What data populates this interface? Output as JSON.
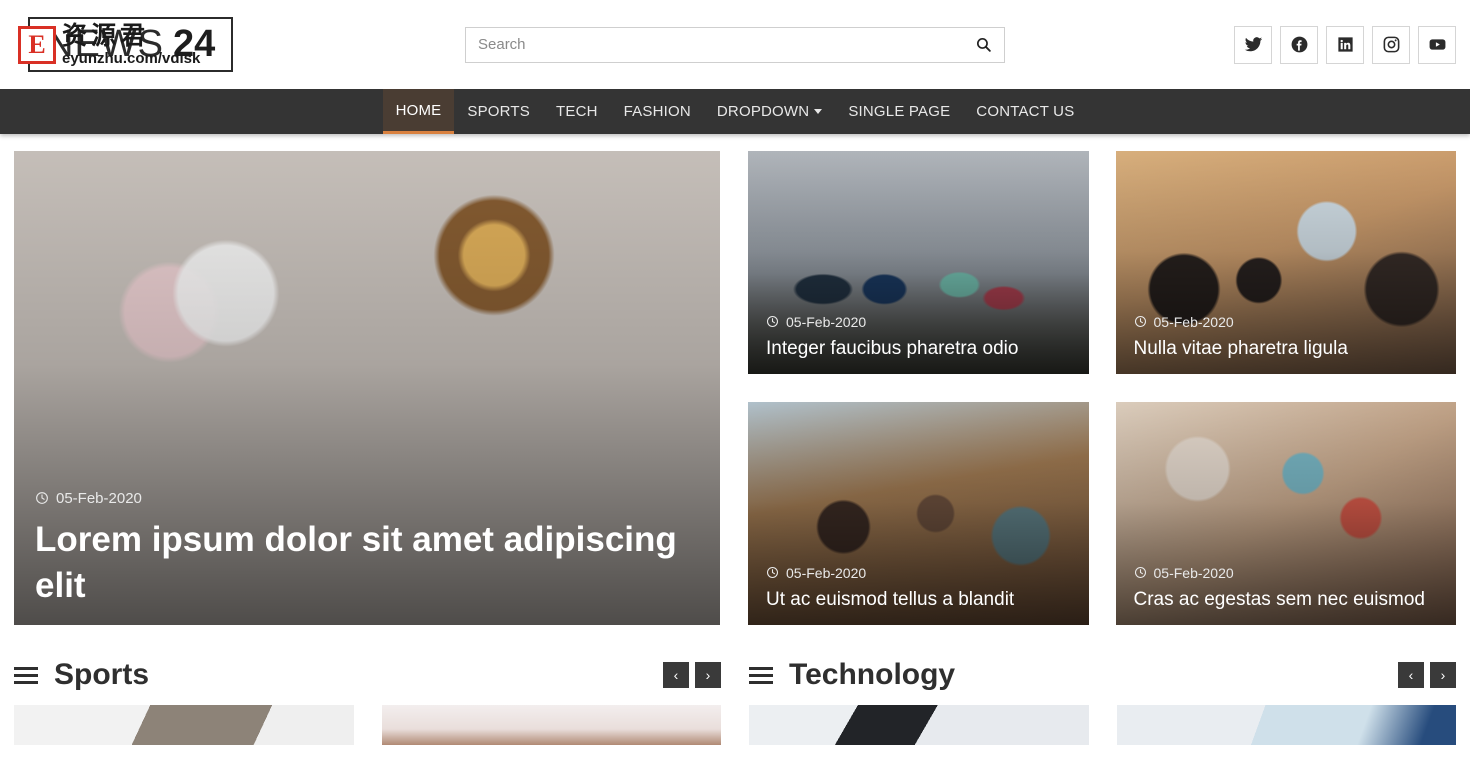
{
  "header": {
    "logo": {
      "word": "NEWS",
      "number": "24"
    },
    "watermark": {
      "badge_letter": "E",
      "chinese": "资源君",
      "url": "eyunzhu.com/vdisk"
    },
    "search": {
      "placeholder": "Search",
      "value": "",
      "icon": "search-icon",
      "button_label": ""
    },
    "socials": [
      {
        "name": "twitter-icon",
        "label": "Twitter"
      },
      {
        "name": "facebook-icon",
        "label": "Facebook"
      },
      {
        "name": "linkedin-icon",
        "label": "LinkedIn"
      },
      {
        "name": "instagram-icon",
        "label": "Instagram"
      },
      {
        "name": "youtube-icon",
        "label": "YouTube"
      }
    ]
  },
  "nav": {
    "active_index": 0,
    "items": [
      {
        "label": "HOME",
        "has_caret": false
      },
      {
        "label": "SPORTS",
        "has_caret": false
      },
      {
        "label": "TECH",
        "has_caret": false
      },
      {
        "label": "FASHION",
        "has_caret": false
      },
      {
        "label": "DROPDOWN",
        "has_caret": true
      },
      {
        "label": "SINGLE PAGE",
        "has_caret": false
      },
      {
        "label": "CONTACT US",
        "has_caret": false
      }
    ]
  },
  "feature": {
    "date": "05-Feb-2020",
    "title": "Lorem ipsum dolor sit amet adipiscing elit",
    "image": "img-flatlay",
    "date_icon": "clock-icon"
  },
  "cards": [
    {
      "date": "05-Feb-2020",
      "title": "Integer faucibus pharetra odio",
      "image": "img-runners",
      "date_icon": "clock-icon"
    },
    {
      "date": "05-Feb-2020",
      "title": "Nulla vitae pharetra ligula",
      "image": "img-office",
      "date_icon": "clock-icon"
    },
    {
      "date": "05-Feb-2020",
      "title": "Ut ac euismod tellus a blandit",
      "image": "img-conference",
      "date_icon": "clock-icon"
    },
    {
      "date": "05-Feb-2020",
      "title": "Cras ac egestas sem nec euismod",
      "image": "img-desk",
      "date_icon": "clock-icon"
    }
  ],
  "sections": [
    {
      "title": "Sports",
      "menu_icon": "hamburger-icon",
      "prev_label": "‹",
      "next_label": "›",
      "thumbs": [
        "img-window",
        "img-person"
      ]
    },
    {
      "title": "Technology",
      "menu_icon": "hamburger-icon",
      "prev_label": "‹",
      "next_label": "›",
      "thumbs": [
        "img-tech",
        "img-tablet"
      ]
    }
  ],
  "colors": {
    "navbar_bg": "#343434",
    "nav_active_bg": "#4a3d33",
    "nav_active_accent": "#d9813f",
    "text_dark": "#2f2f2f",
    "watermark_red": "#d93025"
  }
}
